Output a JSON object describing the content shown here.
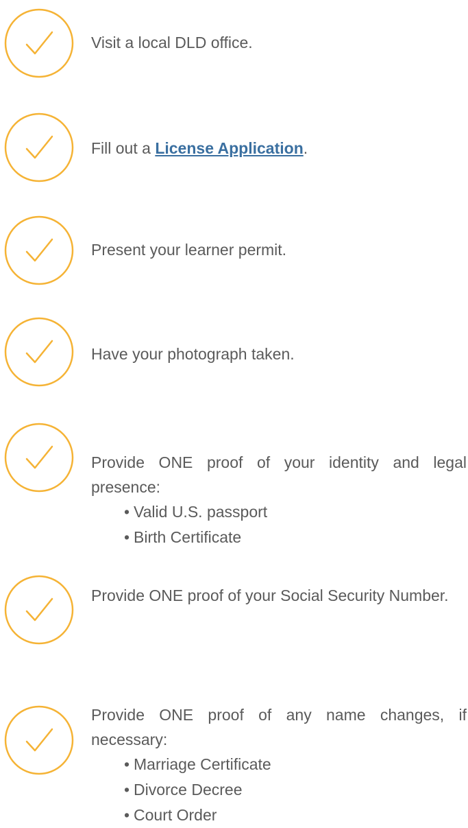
{
  "colors": {
    "accent": "#f5b335",
    "text": "#5a5a5a",
    "link": "#3a6fa0"
  },
  "steps": [
    {
      "text": "Visit a local DLD office."
    },
    {
      "prefix": "Fill out a ",
      "link": "License Application",
      "suffix": "."
    },
    {
      "text": "Present your learner permit."
    },
    {
      "text": "Have your photograph taken."
    },
    {
      "text": "Provide ONE proof of your identity and legal presence:",
      "items": [
        "Valid U.S. passport",
        "Birth Certificate"
      ]
    },
    {
      "text": "Provide ONE proof of your Social Security Number."
    },
    {
      "text": "Provide ONE proof of any name changes, if necessary:",
      "items": [
        "Marriage Certificate",
        "Divorce Decree",
        "Court Order"
      ]
    }
  ]
}
